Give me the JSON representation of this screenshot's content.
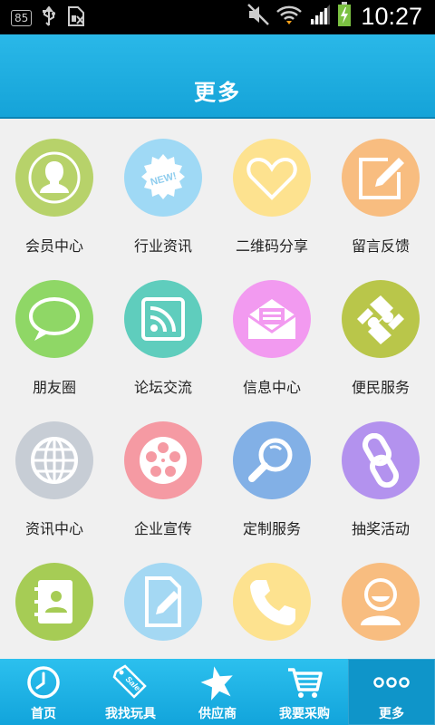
{
  "status_bar": {
    "badge": "85",
    "time": "10:27"
  },
  "header": {
    "title": "更多"
  },
  "grid_items": [
    {
      "label": "会员中心",
      "icon": "member-icon",
      "color": "#b7d26a"
    },
    {
      "label": "行业资讯",
      "icon": "news-icon",
      "color": "#9fd9f5"
    },
    {
      "label": "二维码分享",
      "icon": "heart-icon",
      "color": "#fde28f"
    },
    {
      "label": "留言反馈",
      "icon": "edit-icon",
      "color": "#f8bd80"
    },
    {
      "label": "朋友圈",
      "icon": "chat-icon",
      "color": "#8fd766"
    },
    {
      "label": "论坛交流",
      "icon": "rss-icon",
      "color": "#5fcdbd"
    },
    {
      "label": "信息中心",
      "icon": "mail-icon",
      "color": "#f29af0"
    },
    {
      "label": "便民服务",
      "icon": "puzzle-icon",
      "color": "#b9c64a"
    },
    {
      "label": "资讯中心",
      "icon": "globe-icon",
      "color": "#c7cdd5"
    },
    {
      "label": "企业宣传",
      "icon": "film-icon",
      "color": "#f59aa3"
    },
    {
      "label": "定制服务",
      "icon": "search-icon",
      "color": "#82b0e6"
    },
    {
      "label": "抽奖活动",
      "icon": "link-icon",
      "color": "#b392ee"
    },
    {
      "label": "",
      "icon": "contacts-icon",
      "color": "#a6cc55"
    },
    {
      "label": "",
      "icon": "document-icon",
      "color": "#a4d8f3"
    },
    {
      "label": "",
      "icon": "phone-icon",
      "color": "#fde28f"
    },
    {
      "label": "",
      "icon": "smiley-icon",
      "color": "#f8bd80"
    }
  ],
  "tabs": [
    {
      "label": "首页",
      "icon": "clock-icon"
    },
    {
      "label": "我找玩具",
      "icon": "sale-tag-icon"
    },
    {
      "label": "供应商",
      "icon": "star-icon"
    },
    {
      "label": "我要采购",
      "icon": "cart-icon"
    },
    {
      "label": "更多",
      "icon": "more-dots-icon",
      "active": true
    }
  ]
}
